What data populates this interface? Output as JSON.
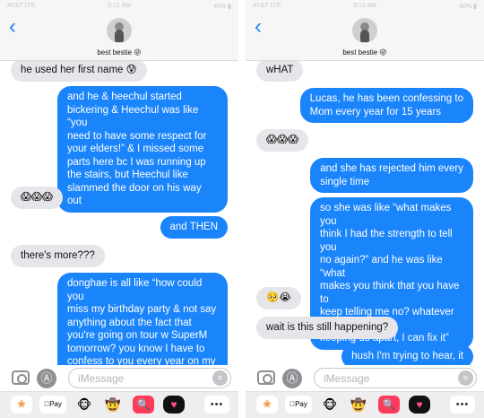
{
  "screens": [
    {
      "status": {
        "carrier": "AT&T LTE",
        "time": "9:12 AM",
        "battery": "40% ▮"
      },
      "contact_name": "best bestie 😜",
      "messages": [
        {
          "dir": "recv",
          "text": "he used her first name 😰"
        },
        {
          "dir": "sent",
          "text": "and he & heechul started\nbickering & Heechul was like “you\nneed to have some respect for\nyour elders!” & I missed some\nparts here bc I was running up\nthe stairs, but Heechul like\nslammed the door on his way out"
        },
        {
          "dir": "recv",
          "text": "😱😱😱"
        },
        {
          "dir": "sent",
          "text": "and THEN"
        },
        {
          "dir": "recv",
          "text": "there's more???"
        },
        {
          "dir": "sent",
          "text": "donghae is all like “how could you\nmiss my birthday party & not say\nanything about the fact that\nyou're going on tour w SuperM\ntomorrow? you know I have to\nconfess to you every year on my\nbirthday”"
        }
      ],
      "input_placeholder": "iMessage"
    },
    {
      "status": {
        "carrier": "AT&T LTE",
        "time": "9:13 AM",
        "battery": "40% ▮"
      },
      "contact_name": "best bestie 😜",
      "messages": [
        {
          "dir": "recv",
          "text": "wHAT"
        },
        {
          "dir": "sent",
          "text": "Lucas, he has been confessing to\nMom every year for 15 years"
        },
        {
          "dir": "recv",
          "text": "😱😱😱"
        },
        {
          "dir": "sent",
          "text": "and she has rejected him every\nsingle time"
        },
        {
          "dir": "sent",
          "text": "so she was like “what makes you\nthink I had the strength to tell you\nno again?” and he was like “what\nmakes you think that you have to\nkeep telling me no? whatever is\nkeeping us apart, I can fix it”"
        },
        {
          "dir": "recv",
          "text": "🥺😭"
        },
        {
          "dir": "recv",
          "text": "wait is this still happening?"
        },
        {
          "dir": "sent",
          "text": "hush I'm trying to hear, it"
        }
      ],
      "input_placeholder": "iMessage"
    }
  ],
  "icons": {
    "back": "chevron-left-icon",
    "camera": "camera-icon",
    "appstore": "app-store-icon",
    "mic": "audio-waveform-icon",
    "drawer": [
      "photos-app-icon",
      "apple-pay-icon",
      "memoji-icon",
      "memoji-icon",
      "image-search-icon",
      "digital-touch-icon",
      "more-apps-icon"
    ]
  },
  "drawer_labels": {
    "pay": "Pay",
    "more": "•••"
  },
  "colors": {
    "sent_bubble": "#1a84fb",
    "received_bubble": "#e6e6ea",
    "accent": "#1a84fb"
  }
}
